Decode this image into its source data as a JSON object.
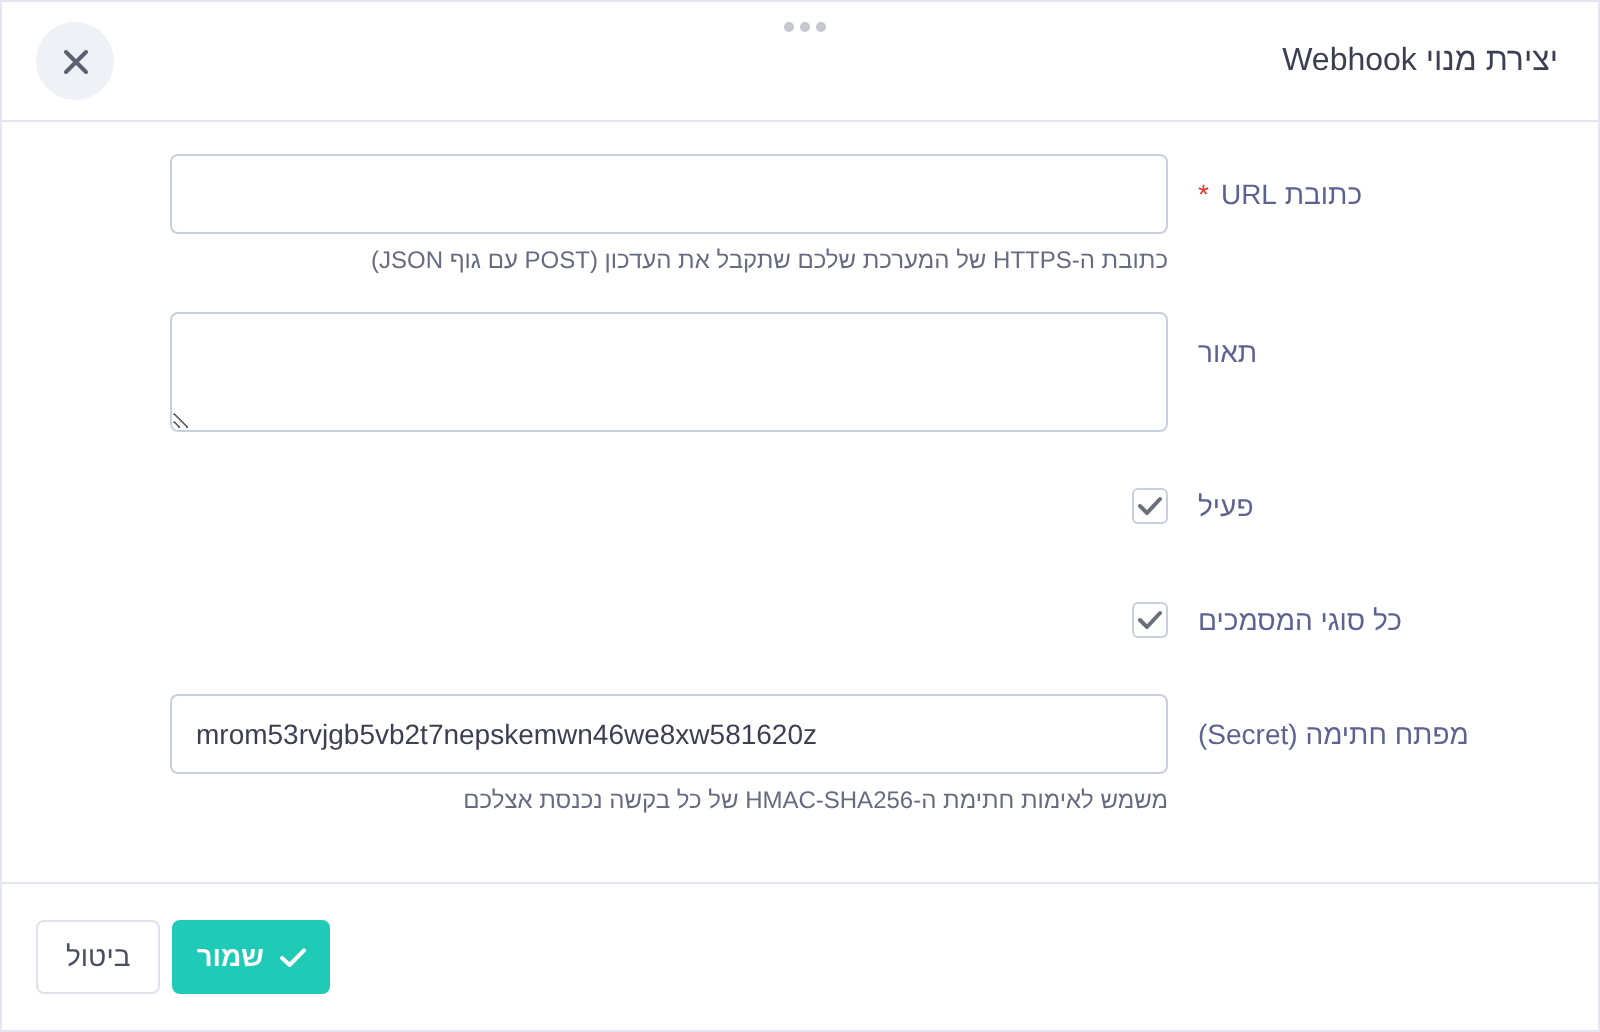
{
  "dialog": {
    "title": "יצירת מנוי Webhook"
  },
  "fields": [
    {
      "kind": "text",
      "label": "כתובת URL",
      "required_mark": "*",
      "hint": "כתובת ה-HTTPS של המערכת שלכם שתקבל את העדכון (POST עם גוף JSON)"
    },
    {
      "kind": "textarea",
      "label": "תאור"
    },
    {
      "kind": "checkbox",
      "label": "פעיל",
      "checked": true
    },
    {
      "kind": "checkbox",
      "label": "כל סוגי המסמכים",
      "checked": true
    },
    {
      "kind": "text",
      "label": "מפתח חתימה (Secret)",
      "value": "mrom53rvjgb5vb2t7nepskemwn46we8xw581620z",
      "hint": "משמש לאימות חתימת ה-HMAC-SHA256 של כל בקשה נכנסת אצלכם"
    }
  ],
  "buttons": [
    {
      "kind": "primary",
      "label": "שמור"
    },
    {
      "kind": "secondary",
      "label": "ביטול"
    }
  ]
}
